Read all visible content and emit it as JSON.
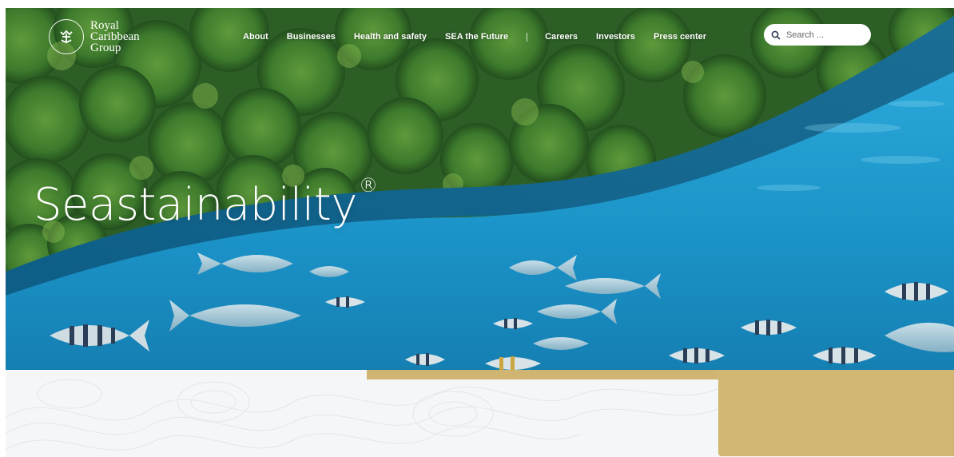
{
  "brand": {
    "name_line1": "Royal",
    "name_line2": "Caribbean",
    "name_line3": "Group"
  },
  "nav": {
    "primary": [
      "About",
      "Businesses",
      "Health and safety",
      "SEA the Future"
    ],
    "secondary": [
      "Careers",
      "Investors",
      "Press center"
    ]
  },
  "search": {
    "placeholder": "Search ..."
  },
  "hero": {
    "title": "Seastainability",
    "title_mark": "®"
  },
  "colors": {
    "ocean": "#1a9fd0",
    "forest": "#2f6a2a",
    "gold": "#d1b772",
    "background": "#f5f6f7"
  },
  "icons": {
    "logo": "crown-anchor-icon",
    "search": "search-icon"
  }
}
